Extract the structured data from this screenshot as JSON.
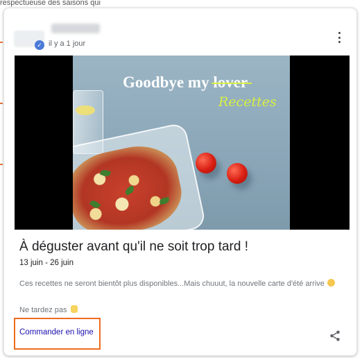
{
  "background_text": "respectueuse des saisons qui",
  "post": {
    "posted_time": "il y a 1 jour",
    "image_text": {
      "headline_prefix": "Goodbye my",
      "headline_struck": "lover",
      "script_word": "Recettes"
    },
    "title": "À déguster avant qu'il ne soit trop tard !",
    "dates": "13 juin - 26 juin",
    "description": "Ces recettes ne seront bientôt plus disponibles...Mais chuuut, la nouvelle carte d'été arrive",
    "note": "Ne tardez pas",
    "cta_label": "Commander en ligne"
  },
  "icons": {
    "more": "more-vert-icon",
    "share": "share-icon",
    "verified": "verified-badge-icon"
  },
  "colors": {
    "highlight_border": "#ef6b1f",
    "link": "#1a0dab",
    "accent_text": "#d8ef43"
  }
}
